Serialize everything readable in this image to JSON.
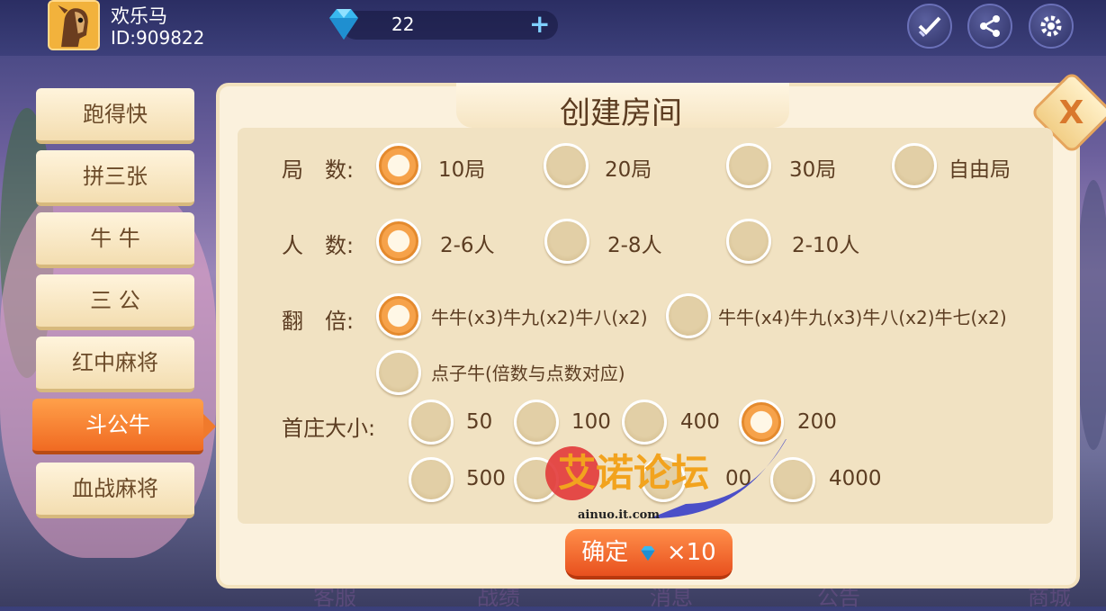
{
  "user": {
    "name": "欢乐马",
    "id": "ID:909822"
  },
  "currency": {
    "gems": "22",
    "plus": "+"
  },
  "header_icons": [
    "check-icon",
    "share-icon",
    "gear-icon"
  ],
  "sidebar": {
    "items": [
      {
        "label": "跑得快"
      },
      {
        "label": "拼三张"
      },
      {
        "label": "牛  牛"
      },
      {
        "label": "三  公"
      },
      {
        "label": "红中麻将"
      },
      {
        "label": "斗公牛",
        "active": true
      },
      {
        "label": "血战麻将"
      }
    ]
  },
  "dialog": {
    "title": "创建房间",
    "close": "X",
    "rounds": {
      "label": "局　数:",
      "options": [
        "10局",
        "20局",
        "30局",
        "自由局"
      ],
      "selected": 0
    },
    "players": {
      "label": "人　数:",
      "options": [
        "2-6人",
        "2-8人",
        "2-10人"
      ],
      "selected": 0
    },
    "multiplier": {
      "label": "翻　倍:",
      "options": [
        "牛牛(x3)牛九(x2)牛八(x2)",
        "牛牛(x4)牛九(x3)牛八(x2)牛七(x2)",
        "点子牛(倍数与点数对应)"
      ],
      "selected": 0
    },
    "banker": {
      "label": "首庄大小:",
      "options": [
        "50",
        "100",
        "400",
        "200",
        "500",
        "00",
        "4000"
      ],
      "selected": 3
    },
    "confirm": {
      "label": "确定",
      "cost": "×10"
    }
  },
  "bottom_nav": [
    "客服",
    "战绩",
    "消息",
    "公告",
    "商城"
  ],
  "watermark": {
    "text": "艾诺论坛",
    "url": "ainuo.it.com"
  },
  "colors": {
    "accent": "#f06a22",
    "panel": "#fbf1dd",
    "text": "#5c3d22"
  }
}
